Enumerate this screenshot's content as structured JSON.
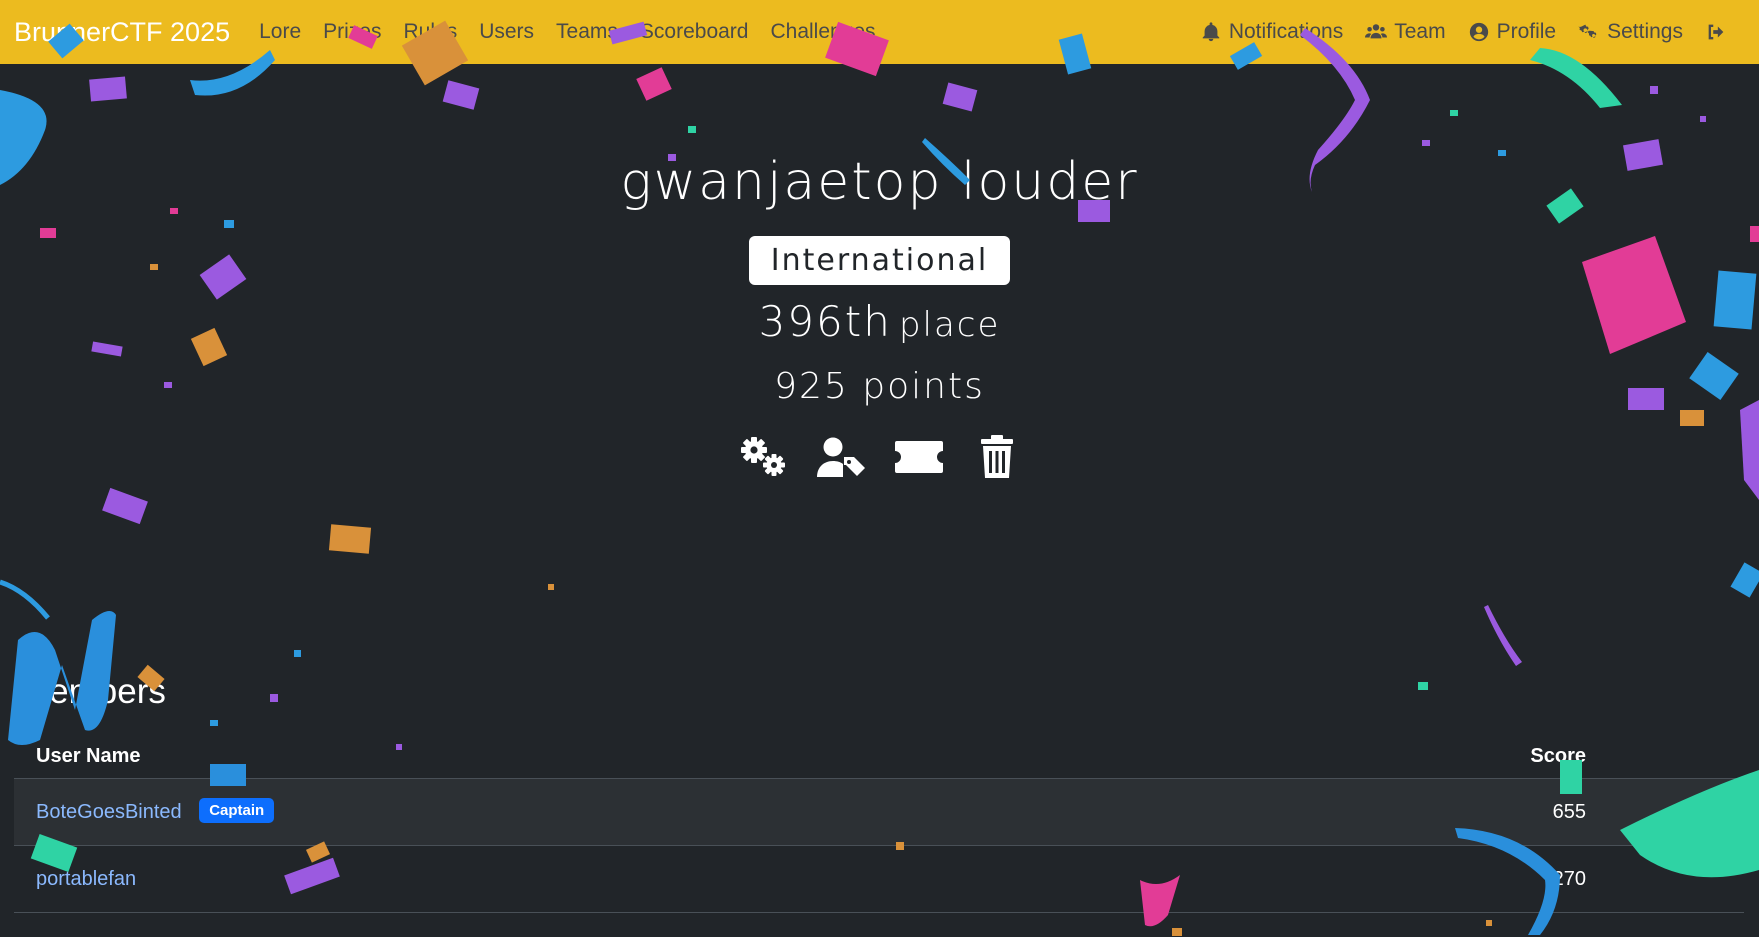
{
  "navbar": {
    "brand": "BrunnerCTF 2025",
    "links": [
      "Lore",
      "Prizes",
      "Rules",
      "Users",
      "Teams",
      "Scoreboard",
      "Challenges"
    ],
    "right": {
      "notifications": "Notifications",
      "team": "Team",
      "profile": "Profile",
      "settings": "Settings"
    },
    "icons": {
      "notifications": "bell-icon",
      "team": "users-icon",
      "profile": "user-circle-icon",
      "settings": "gears-icon",
      "logout": "logout-icon"
    }
  },
  "team": {
    "name": "gwanjaetop louder",
    "affiliation": "International",
    "place_number": "396th",
    "place_word": "place",
    "points": "925 points",
    "action_icons": [
      "settings-gears-icon",
      "user-tag-icon",
      "ticket-icon",
      "trash-icon"
    ]
  },
  "members": {
    "title": "Members",
    "columns": {
      "user": "User Name",
      "score": "Score"
    },
    "rows": [
      {
        "name": "BoteGoesBinted",
        "badge": "Captain",
        "score": "655"
      },
      {
        "name": "portablefan",
        "badge": "",
        "score": "270"
      }
    ]
  },
  "colors": {
    "navbar": "#ecbb1f",
    "background": "#212529",
    "link": "#8bb9fe",
    "badge": "#0d6efd"
  }
}
